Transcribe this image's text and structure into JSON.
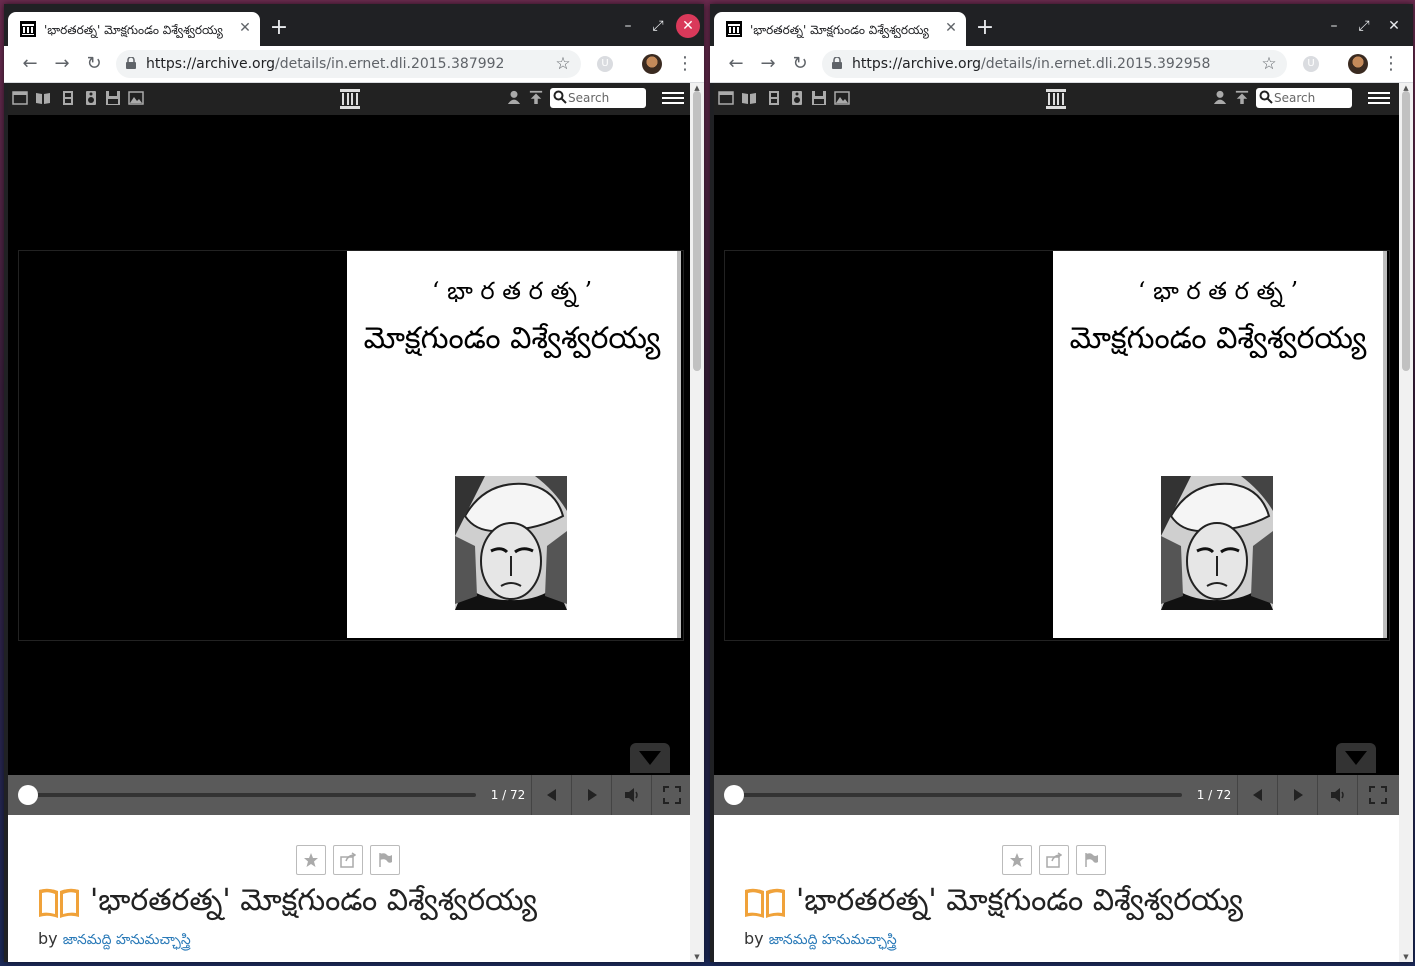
{
  "windows": [
    {
      "id": "left",
      "tab": {
        "title": "'భారతరత్న' మోక్షగుండం విశ్వేశ్వరయ్య"
      },
      "address": {
        "scheme_host": "https://archive.org",
        "path": "/details/in.ernet.dli.2015.387992"
      },
      "ia_search_placeholder": "Search",
      "book": {
        "line1": "‘ భా ర త ర త్న ’",
        "line2": "మోక్షగుండం విశ్వేశ్వరయ్య"
      },
      "page_indicator": "1 / 72",
      "item": {
        "title": "'భారతరత్న' మోక్షగుండం విశ్వేశ్వరయ్య",
        "by": "by",
        "author": "జానమద్ది హనుమచ్ఛాస్త్రి"
      }
    },
    {
      "id": "right",
      "tab": {
        "title": "'భారతరత్న' మోక్షగుండం విశ్వేశ్వరయ్య"
      },
      "address": {
        "scheme_host": "https://archive.org",
        "path": "/details/in.ernet.dli.2015.392958"
      },
      "ia_search_placeholder": "Search",
      "book": {
        "line1": "‘ భా ర త ర త్న ’",
        "line2": "మోక్షగుండం విశ్వేశ్వరయ్య"
      },
      "page_indicator": "1 / 72",
      "item": {
        "title": "'భారతరత్న' మోక్షగుండం విశ్వేశ్వరయ్య",
        "by": "by",
        "author": "జానమద్ది హనుమచ్ఛాస్త్రి"
      }
    }
  ],
  "colors": {
    "window_close": "#d9395a",
    "link": "#2a7ab8",
    "book_icon": "#f0a23a"
  }
}
